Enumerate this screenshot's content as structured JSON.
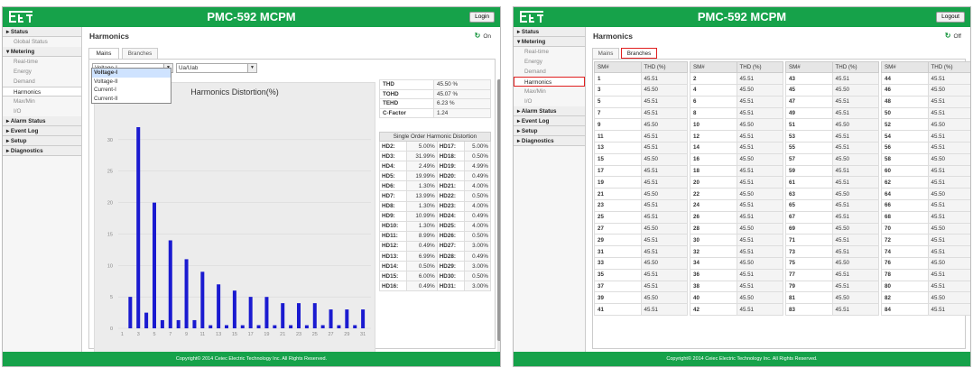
{
  "app": {
    "title": "PMC-592 MCPM",
    "footer": "Copyright© 2014 Ceiec Electric Technology Inc. All Rights Reserved."
  },
  "left": {
    "header_button": "Login",
    "sidebar": [
      {
        "label": "Status",
        "type": "header"
      },
      {
        "label": "Global Status",
        "type": "item"
      },
      {
        "label": "Metering",
        "type": "header",
        "open": true
      },
      {
        "label": "Real-time",
        "type": "item"
      },
      {
        "label": "Energy",
        "type": "item"
      },
      {
        "label": "Demand",
        "type": "item"
      },
      {
        "label": "Harmonics",
        "type": "item",
        "active": true
      },
      {
        "label": "Max/Min",
        "type": "item"
      },
      {
        "label": "I/O",
        "type": "item"
      },
      {
        "label": "Alarm Status",
        "type": "header"
      },
      {
        "label": "Event Log",
        "type": "header"
      },
      {
        "label": "Setup",
        "type": "header"
      },
      {
        "label": "Diagnostics",
        "type": "header"
      }
    ],
    "page_title": "Harmonics",
    "toggle": "On",
    "tabs": [
      "Mains",
      "Branches"
    ],
    "active_tab": "Mains",
    "select1": "Voltage-I",
    "select2": "Ua/Uab",
    "dropdown_options": [
      "Voltage-I",
      "Voltage-II",
      "Current-I",
      "Current-II"
    ],
    "summary": [
      {
        "k": "THD",
        "v": "45.50 %"
      },
      {
        "k": "TOHD",
        "v": "45.07 %"
      },
      {
        "k": "TEHD",
        "v": "6.23 %"
      },
      {
        "k": "C-Factor",
        "v": "1.24"
      }
    ],
    "single_order_title": "Single Order Harmonic Distortion",
    "single_order_rows": [
      [
        "HD2:",
        "5.00%",
        "HD17:",
        "5.00%"
      ],
      [
        "HD3:",
        "31.99%",
        "HD18:",
        "0.50%"
      ],
      [
        "HD4:",
        "2.49%",
        "HD19:",
        "4.99%"
      ],
      [
        "HD5:",
        "19.99%",
        "HD20:",
        "0.49%"
      ],
      [
        "HD6:",
        "1.30%",
        "HD21:",
        "4.00%"
      ],
      [
        "HD7:",
        "13.99%",
        "HD22:",
        "0.50%"
      ],
      [
        "HD8:",
        "1.30%",
        "HD23:",
        "4.00%"
      ],
      [
        "HD9:",
        "10.99%",
        "HD24:",
        "0.49%"
      ],
      [
        "HD10:",
        "1.30%",
        "HD25:",
        "4.00%"
      ],
      [
        "HD11:",
        "8.99%",
        "HD26:",
        "0.50%"
      ],
      [
        "HD12:",
        "0.49%",
        "HD27:",
        "3.00%"
      ],
      [
        "HD13:",
        "6.99%",
        "HD28:",
        "0.49%"
      ],
      [
        "HD14:",
        "0.50%",
        "HD29:",
        "3.00%"
      ],
      [
        "HD15:",
        "6.00%",
        "HD30:",
        "0.50%"
      ],
      [
        "HD16:",
        "0.49%",
        "HD31:",
        "3.00%"
      ]
    ]
  },
  "chart_data": {
    "type": "bar",
    "title": "Harmonics Distortion(%)",
    "bar_color": "#1a1ad0",
    "x": [
      2,
      3,
      4,
      5,
      6,
      7,
      8,
      9,
      10,
      11,
      12,
      13,
      14,
      15,
      16,
      17,
      18,
      19,
      20,
      21,
      22,
      23,
      24,
      25,
      26,
      27,
      28,
      29,
      30,
      31
    ],
    "values": [
      5.0,
      31.99,
      2.49,
      19.99,
      1.3,
      13.99,
      1.3,
      10.99,
      1.3,
      8.99,
      0.49,
      6.99,
      0.5,
      6.0,
      0.49,
      5.0,
      0.5,
      4.99,
      0.49,
      4.0,
      0.5,
      4.0,
      0.49,
      4.0,
      0.5,
      3.0,
      0.49,
      3.0,
      0.5,
      3.0
    ],
    "x_ticks": [
      1,
      3,
      5,
      7,
      9,
      11,
      13,
      15,
      17,
      19,
      21,
      23,
      25,
      27,
      29,
      31
    ],
    "y_ticks": [
      0,
      5,
      10,
      15,
      20,
      25,
      30
    ],
    "ylim": [
      0,
      35
    ]
  },
  "right": {
    "header_button": "Logout",
    "sidebar": [
      {
        "label": "Status",
        "type": "header"
      },
      {
        "label": "Metering",
        "type": "header",
        "open": true
      },
      {
        "label": "Real-time",
        "type": "item"
      },
      {
        "label": "Energy",
        "type": "item"
      },
      {
        "label": "Demand",
        "type": "item"
      },
      {
        "label": "Harmonics",
        "type": "item",
        "active": true,
        "boxed": true
      },
      {
        "label": "Max/Min",
        "type": "item"
      },
      {
        "label": "I/O",
        "type": "item"
      },
      {
        "label": "Alarm Status",
        "type": "header"
      },
      {
        "label": "Event Log",
        "type": "header"
      },
      {
        "label": "Setup",
        "type": "header"
      },
      {
        "label": "Diagnostics",
        "type": "header"
      }
    ],
    "page_title": "Harmonics",
    "toggle": "Off",
    "tabs": [
      "Mains",
      "Branches"
    ],
    "active_tab": "Branches",
    "grid_headers": [
      "SM#",
      "THD (%)"
    ],
    "branches": [
      [
        [
          "1",
          "45.51"
        ],
        [
          "2",
          "45.51"
        ],
        [
          "43",
          "45.51"
        ],
        [
          "44",
          "45.51"
        ]
      ],
      [
        [
          "3",
          "45.50"
        ],
        [
          "4",
          "45.50"
        ],
        [
          "45",
          "45.50"
        ],
        [
          "46",
          "45.50"
        ]
      ],
      [
        [
          "5",
          "45.51"
        ],
        [
          "6",
          "45.51"
        ],
        [
          "47",
          "45.51"
        ],
        [
          "48",
          "45.51"
        ]
      ],
      [
        [
          "7",
          "45.51"
        ],
        [
          "8",
          "45.51"
        ],
        [
          "49",
          "45.51"
        ],
        [
          "50",
          "45.51"
        ]
      ],
      [
        [
          "9",
          "45.50"
        ],
        [
          "10",
          "45.50"
        ],
        [
          "51",
          "45.50"
        ],
        [
          "52",
          "45.50"
        ]
      ],
      [
        [
          "11",
          "45.51"
        ],
        [
          "12",
          "45.51"
        ],
        [
          "53",
          "45.51"
        ],
        [
          "54",
          "45.51"
        ]
      ],
      [
        [
          "13",
          "45.51"
        ],
        [
          "14",
          "45.51"
        ],
        [
          "55",
          "45.51"
        ],
        [
          "56",
          "45.51"
        ]
      ],
      [
        [
          "15",
          "45.50"
        ],
        [
          "16",
          "45.50"
        ],
        [
          "57",
          "45.50"
        ],
        [
          "58",
          "45.50"
        ]
      ],
      [
        [
          "17",
          "45.51"
        ],
        [
          "18",
          "45.51"
        ],
        [
          "59",
          "45.51"
        ],
        [
          "60",
          "45.51"
        ]
      ],
      [
        [
          "19",
          "45.51"
        ],
        [
          "20",
          "45.51"
        ],
        [
          "61",
          "45.51"
        ],
        [
          "62",
          "45.51"
        ]
      ],
      [
        [
          "21",
          "45.50"
        ],
        [
          "22",
          "45.50"
        ],
        [
          "63",
          "45.50"
        ],
        [
          "64",
          "45.50"
        ]
      ],
      [
        [
          "23",
          "45.51"
        ],
        [
          "24",
          "45.51"
        ],
        [
          "65",
          "45.51"
        ],
        [
          "66",
          "45.51"
        ]
      ],
      [
        [
          "25",
          "45.51"
        ],
        [
          "26",
          "45.51"
        ],
        [
          "67",
          "45.51"
        ],
        [
          "68",
          "45.51"
        ]
      ],
      [
        [
          "27",
          "45.50"
        ],
        [
          "28",
          "45.50"
        ],
        [
          "69",
          "45.50"
        ],
        [
          "70",
          "45.50"
        ]
      ],
      [
        [
          "29",
          "45.51"
        ],
        [
          "30",
          "45.51"
        ],
        [
          "71",
          "45.51"
        ],
        [
          "72",
          "45.51"
        ]
      ],
      [
        [
          "31",
          "45.51"
        ],
        [
          "32",
          "45.51"
        ],
        [
          "73",
          "45.51"
        ],
        [
          "74",
          "45.51"
        ]
      ],
      [
        [
          "33",
          "45.50"
        ],
        [
          "34",
          "45.50"
        ],
        [
          "75",
          "45.50"
        ],
        [
          "76",
          "45.50"
        ]
      ],
      [
        [
          "35",
          "45.51"
        ],
        [
          "36",
          "45.51"
        ],
        [
          "77",
          "45.51"
        ],
        [
          "78",
          "45.51"
        ]
      ],
      [
        [
          "37",
          "45.51"
        ],
        [
          "38",
          "45.51"
        ],
        [
          "79",
          "45.51"
        ],
        [
          "80",
          "45.51"
        ]
      ],
      [
        [
          "39",
          "45.50"
        ],
        [
          "40",
          "45.50"
        ],
        [
          "81",
          "45.50"
        ],
        [
          "82",
          "45.50"
        ]
      ],
      [
        [
          "41",
          "45.51"
        ],
        [
          "42",
          "45.51"
        ],
        [
          "83",
          "45.51"
        ],
        [
          "84",
          "45.51"
        ]
      ]
    ]
  }
}
